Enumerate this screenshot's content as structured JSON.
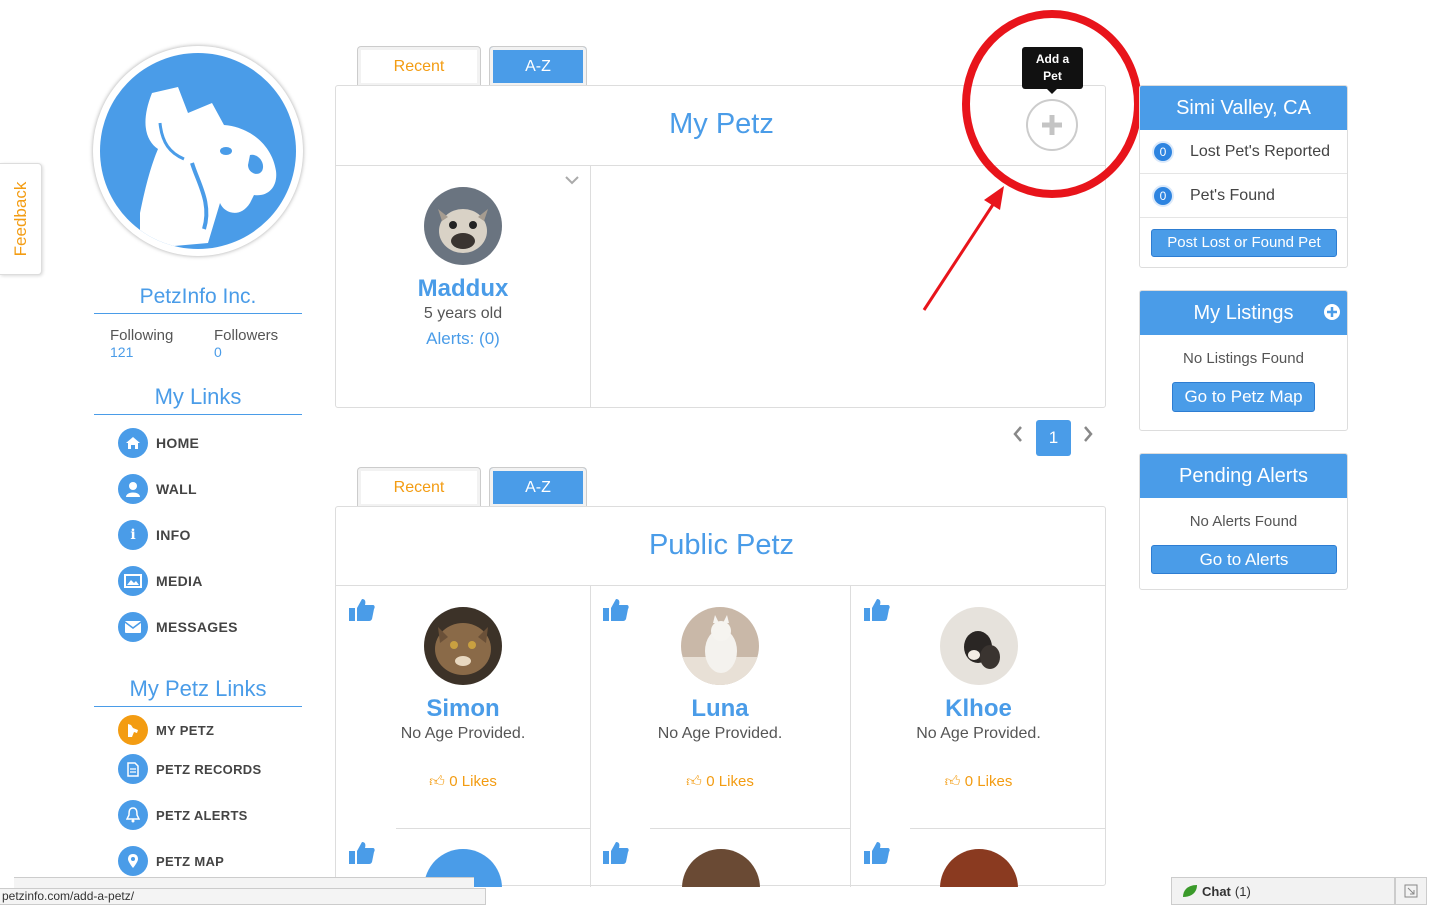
{
  "feedback": {
    "label": "Feedback"
  },
  "sidebar": {
    "org_name": "PetzInfo Inc.",
    "following_label": "Following",
    "following_count": "121",
    "followers_label": "Followers",
    "followers_count": "0",
    "my_links_title": "My Links",
    "my_links": [
      {
        "label": "HOME",
        "icon": "home-icon"
      },
      {
        "label": "WALL",
        "icon": "user-icon"
      },
      {
        "label": "INFO",
        "icon": "info-icon"
      },
      {
        "label": "MEDIA",
        "icon": "image-icon"
      },
      {
        "label": "MESSAGES",
        "icon": "envelope-icon"
      }
    ],
    "my_petz_links_title": "My Petz Links",
    "petz_links": [
      {
        "label": "MY PETZ",
        "icon": "dog-icon"
      },
      {
        "label": "PETZ RECORDS",
        "icon": "document-icon"
      },
      {
        "label": "PETZ ALERTS",
        "icon": "bell-icon"
      },
      {
        "label": "PETZ MAP",
        "icon": "map-pin-icon"
      }
    ]
  },
  "my_petz": {
    "tabs": {
      "recent": "Recent",
      "az": "A-Z"
    },
    "title": "My Petz",
    "add_tooltip": "Add a Pet",
    "pets": [
      {
        "name": "Maddux",
        "age": "5 years old",
        "alerts": "Alerts: (0)"
      }
    ],
    "page": "1"
  },
  "public_petz": {
    "tabs": {
      "recent": "Recent",
      "az": "A-Z"
    },
    "title": "Public Petz",
    "pets": [
      {
        "name": "Simon",
        "age": "No Age Provided.",
        "likes": "0 Likes"
      },
      {
        "name": "Luna",
        "age": "No Age Provided.",
        "likes": "0 Likes"
      },
      {
        "name": "Klhoe",
        "age": "No Age Provided.",
        "likes": "0 Likes"
      }
    ]
  },
  "right": {
    "location": {
      "title": "Simi Valley, CA",
      "lost_count": "0",
      "lost_label": "Lost Pet's Reported",
      "found_count": "0",
      "found_label": "Pet's Found",
      "button": "Post Lost or Found Pet"
    },
    "listings": {
      "title": "My Listings",
      "empty": "No Listings Found",
      "button": "Go to Petz Map"
    },
    "alerts": {
      "title": "Pending Alerts",
      "empty": "No Alerts Found",
      "button": "Go to Alerts"
    }
  },
  "status": {
    "url": "petzinfo.com/add-a-petz/"
  },
  "chat": {
    "label": "Chat",
    "count": "(1)"
  },
  "colors": {
    "brand_blue": "#4a9ce8",
    "accent_orange": "#f39c12",
    "annotation_red": "#e8141b"
  }
}
